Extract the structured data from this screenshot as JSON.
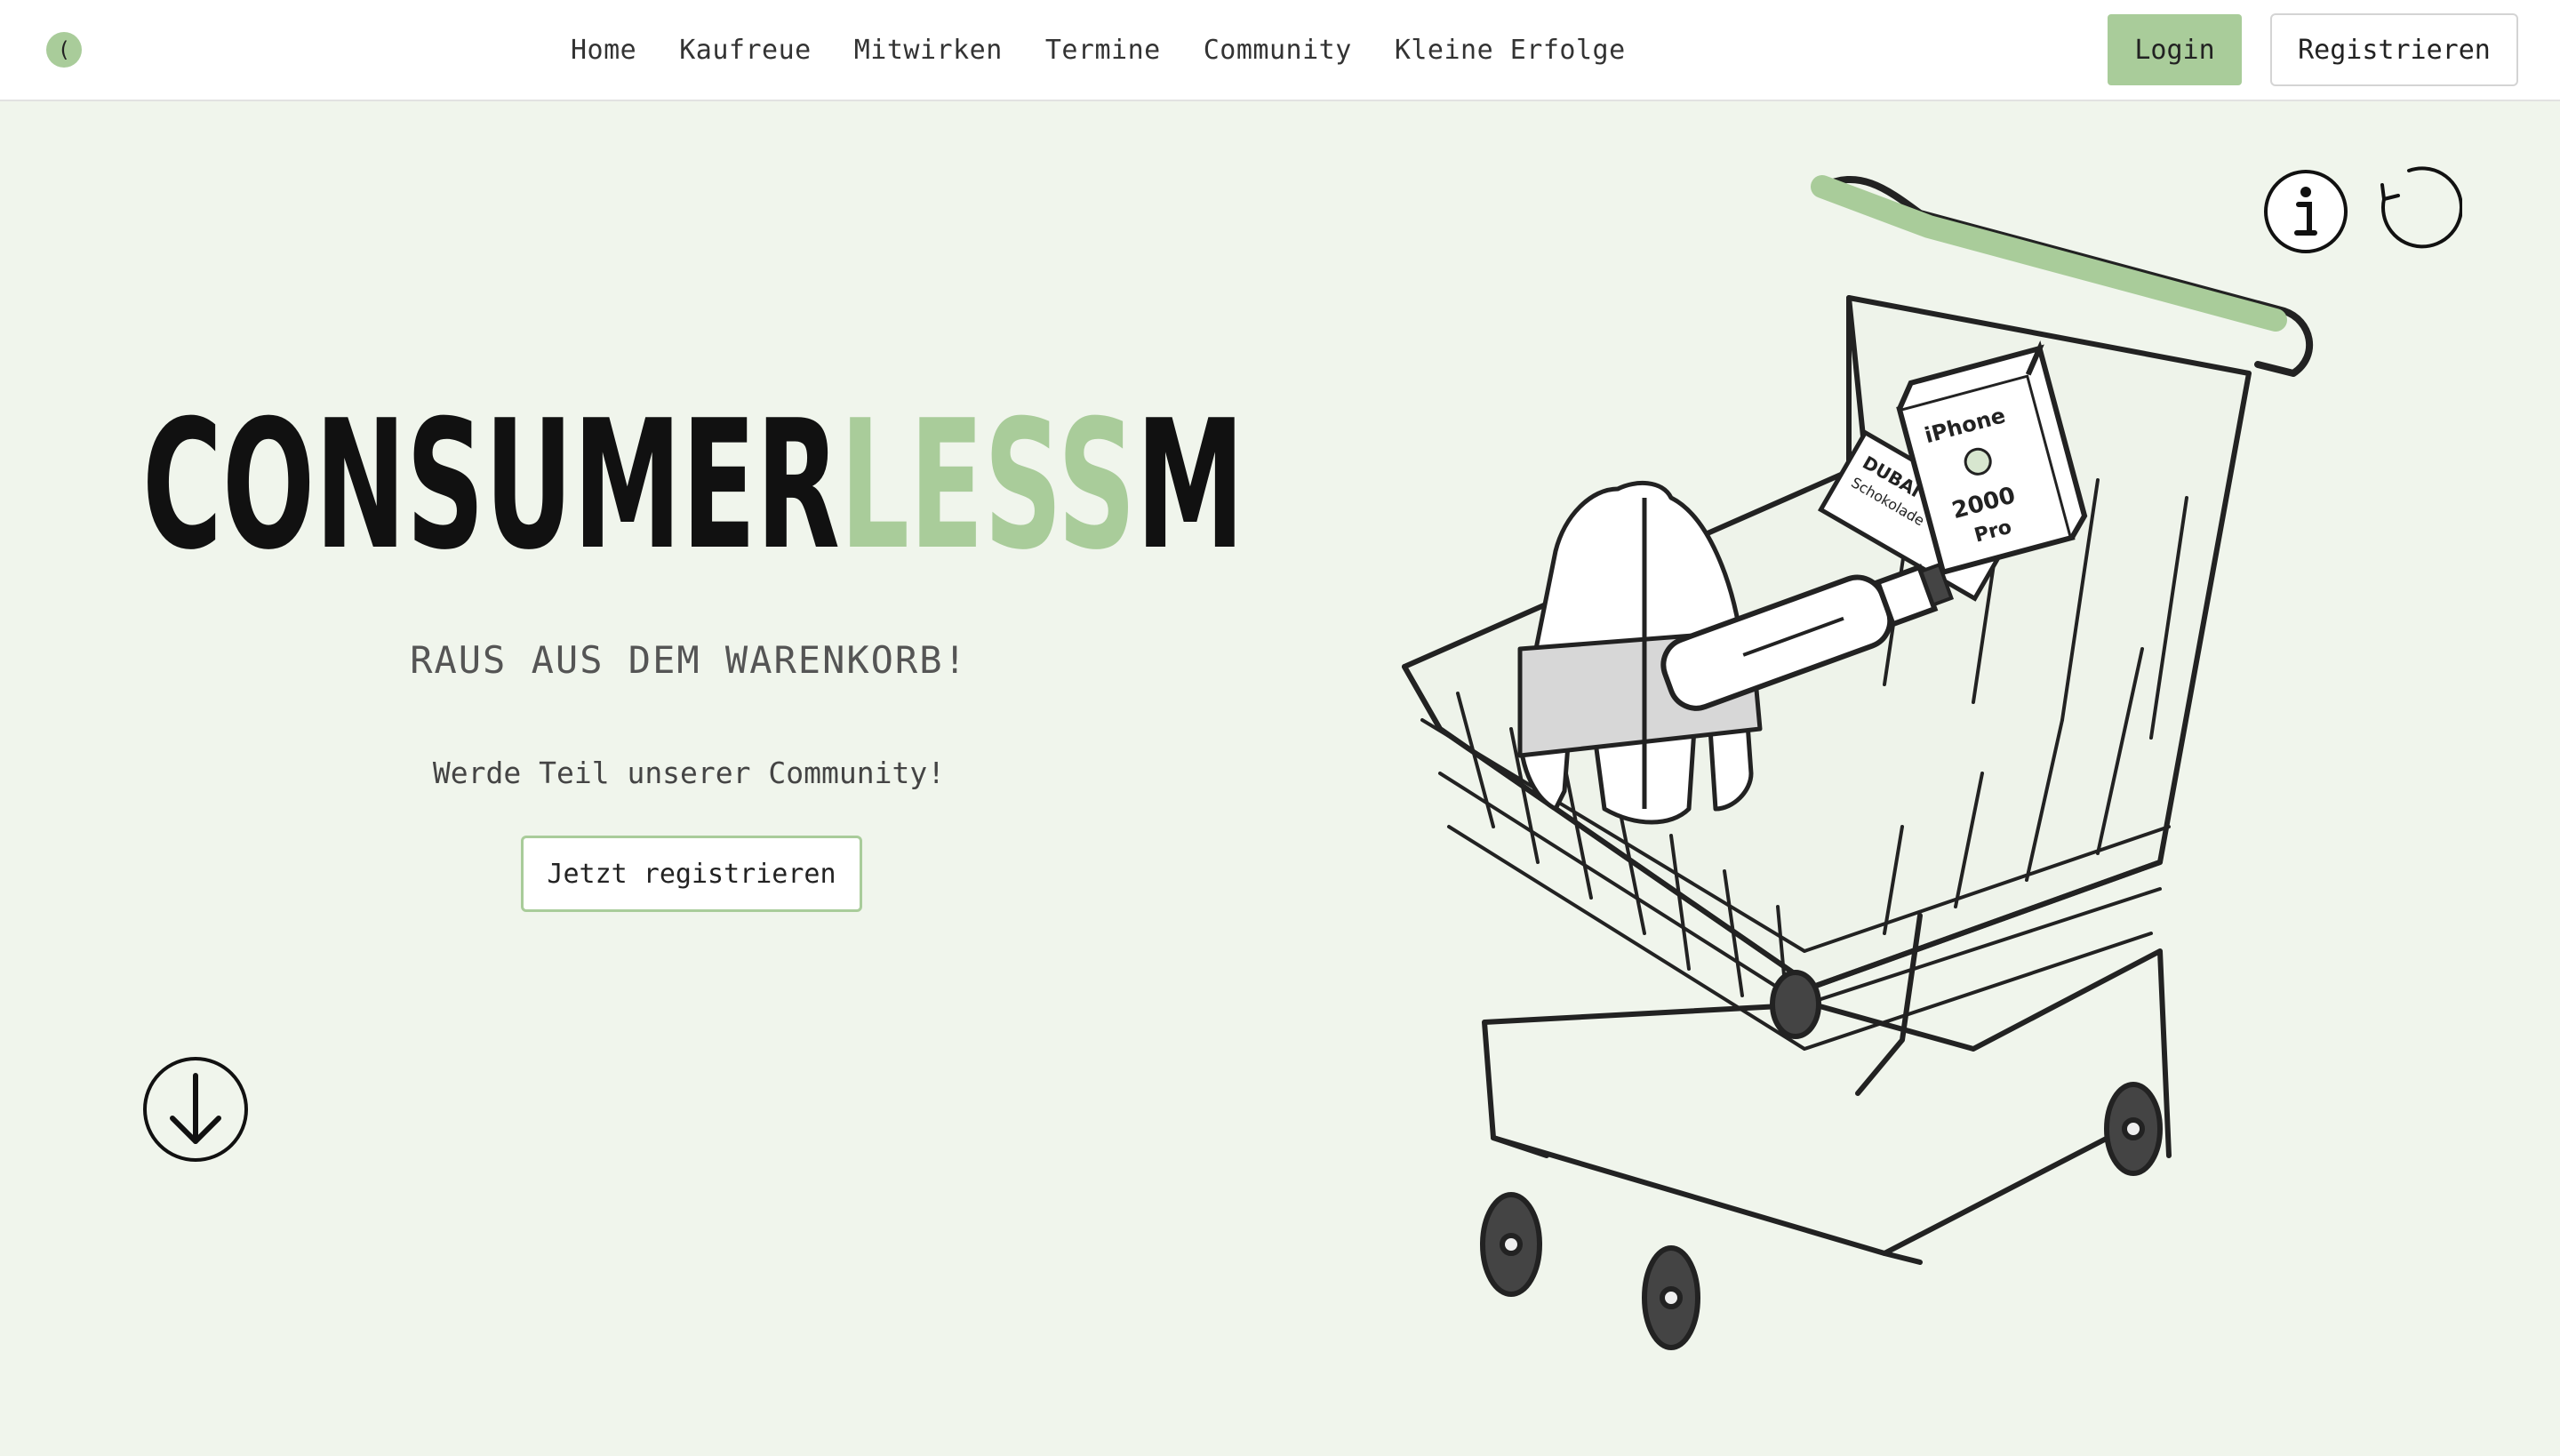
{
  "header": {
    "logo_glyph": "(",
    "nav": [
      {
        "label": "Home"
      },
      {
        "label": "Kaufreue"
      },
      {
        "label": "Mitwirken"
      },
      {
        "label": "Termine"
      },
      {
        "label": "Community"
      },
      {
        "label": "Kleine Erfolge"
      }
    ],
    "login_label": "Login",
    "register_label": "Registrieren"
  },
  "hero": {
    "title_part1": "CONSUMER",
    "title_part2": "LESS",
    "title_part3": "M",
    "tagline": "RAUS AUS DEM WARENKORB!",
    "subline": "Werde Teil unserer Community!",
    "cta_label": "Jetzt registrieren"
  },
  "illustration": {
    "choc_line1": "DUBAI",
    "choc_line2": "Schokolade",
    "phone_line1": "iPhone",
    "phone_line2": "2000",
    "phone_line3": "Pro"
  },
  "icons": {
    "logo": "logo-icon",
    "scroll": "arrow-down-circle-icon",
    "info": "info-circle-icon",
    "reload": "reload-icon"
  },
  "colors": {
    "accent": "#a9cc9a",
    "background": "#f0f5ec",
    "header_bg": "#ffffff",
    "text": "#333333"
  }
}
